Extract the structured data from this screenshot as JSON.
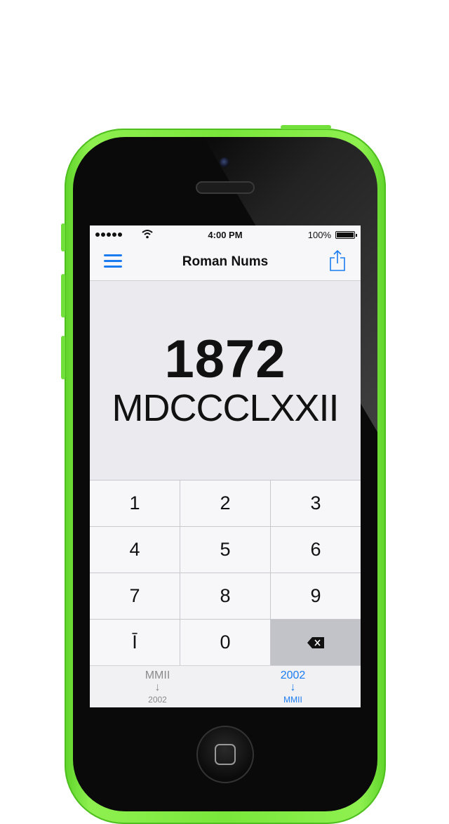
{
  "status_bar": {
    "time": "4:00 PM",
    "battery": "100%"
  },
  "nav": {
    "title": "Roman Nums"
  },
  "display": {
    "arabic": "1872",
    "roman": "MDCCCLXXII"
  },
  "keypad": {
    "keys": [
      "1",
      "2",
      "3",
      "4",
      "5",
      "6",
      "7",
      "8",
      "9",
      "Ī",
      "0"
    ]
  },
  "modes": {
    "roman_to_arabic": {
      "top": "MMII",
      "arrow": "↓",
      "bottom": "2002"
    },
    "arabic_to_roman": {
      "top": "2002",
      "arrow": "↓",
      "bottom": "MMII"
    }
  },
  "colors": {
    "accent": "#1a7cf0",
    "phone": "#79e63b"
  },
  "icons": [
    "menu-icon",
    "share-icon",
    "backspace-icon",
    "wifi-icon",
    "apple-icon",
    "battery-icon"
  ]
}
